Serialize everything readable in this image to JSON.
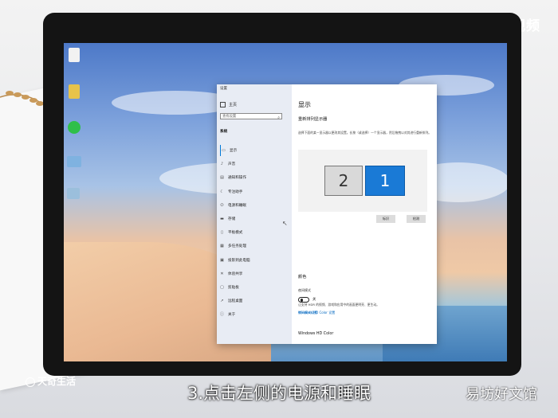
{
  "watermarks": {
    "top_right": "天奇·视频",
    "bottom_left": "天奇生活",
    "bottom_right": "易坊好文馆"
  },
  "caption": "3.点击左侧的电源和睡眠",
  "window": {
    "title": "设置",
    "controls": [
      "—",
      "□",
      "✕"
    ]
  },
  "sidebar": {
    "home": "主页",
    "search_placeholder": "查找设置",
    "section": "系统",
    "items": [
      {
        "icon": "display-icon",
        "glyph": "▭",
        "label": "显示"
      },
      {
        "icon": "sound-icon",
        "glyph": "♪",
        "label": "声音"
      },
      {
        "icon": "notifications-icon",
        "glyph": "▤",
        "label": "通知和操作"
      },
      {
        "icon": "focus-assist-icon",
        "glyph": "☾",
        "label": "专注助手"
      },
      {
        "icon": "power-icon",
        "glyph": "⏻",
        "label": "电源和睡眠"
      },
      {
        "icon": "storage-icon",
        "glyph": "▬",
        "label": "存储"
      },
      {
        "icon": "tablet-icon",
        "glyph": "▯",
        "label": "平板模式"
      },
      {
        "icon": "multitasking-icon",
        "glyph": "▦",
        "label": "多任务处理"
      },
      {
        "icon": "projecting-icon",
        "glyph": "▣",
        "label": "投影到此电脑"
      },
      {
        "icon": "shared-experiences-icon",
        "glyph": "✕",
        "label": "体验共享"
      },
      {
        "icon": "clipboard-icon",
        "glyph": "▢",
        "label": "剪贴板"
      },
      {
        "icon": "remote-desktop-icon",
        "glyph": "↗",
        "label": "远程桌面"
      },
      {
        "icon": "about-icon",
        "glyph": "ⓘ",
        "label": "关于"
      }
    ]
  },
  "main": {
    "title": "显示",
    "subtitle": "重新排列显示器",
    "description": "选择下面的某一显示器以更改其设置。长按（或选择）一个显示器，然后拖拽以对其进行重新排列。",
    "monitors": [
      "2",
      "1"
    ],
    "buttons": {
      "identify": "标识",
      "detect": "检测"
    },
    "color_section": "颜色",
    "night_light_label": "夜间模式",
    "night_light_state": "关",
    "night_light_link": "夜间模式设置",
    "hd_color_section": "Windows HD Color",
    "hd_color_desc": "让支持 HDR 的视频、游戏和应用中的画面更明亮、更生动。",
    "hd_color_link": "Windows HD Color 设置"
  }
}
